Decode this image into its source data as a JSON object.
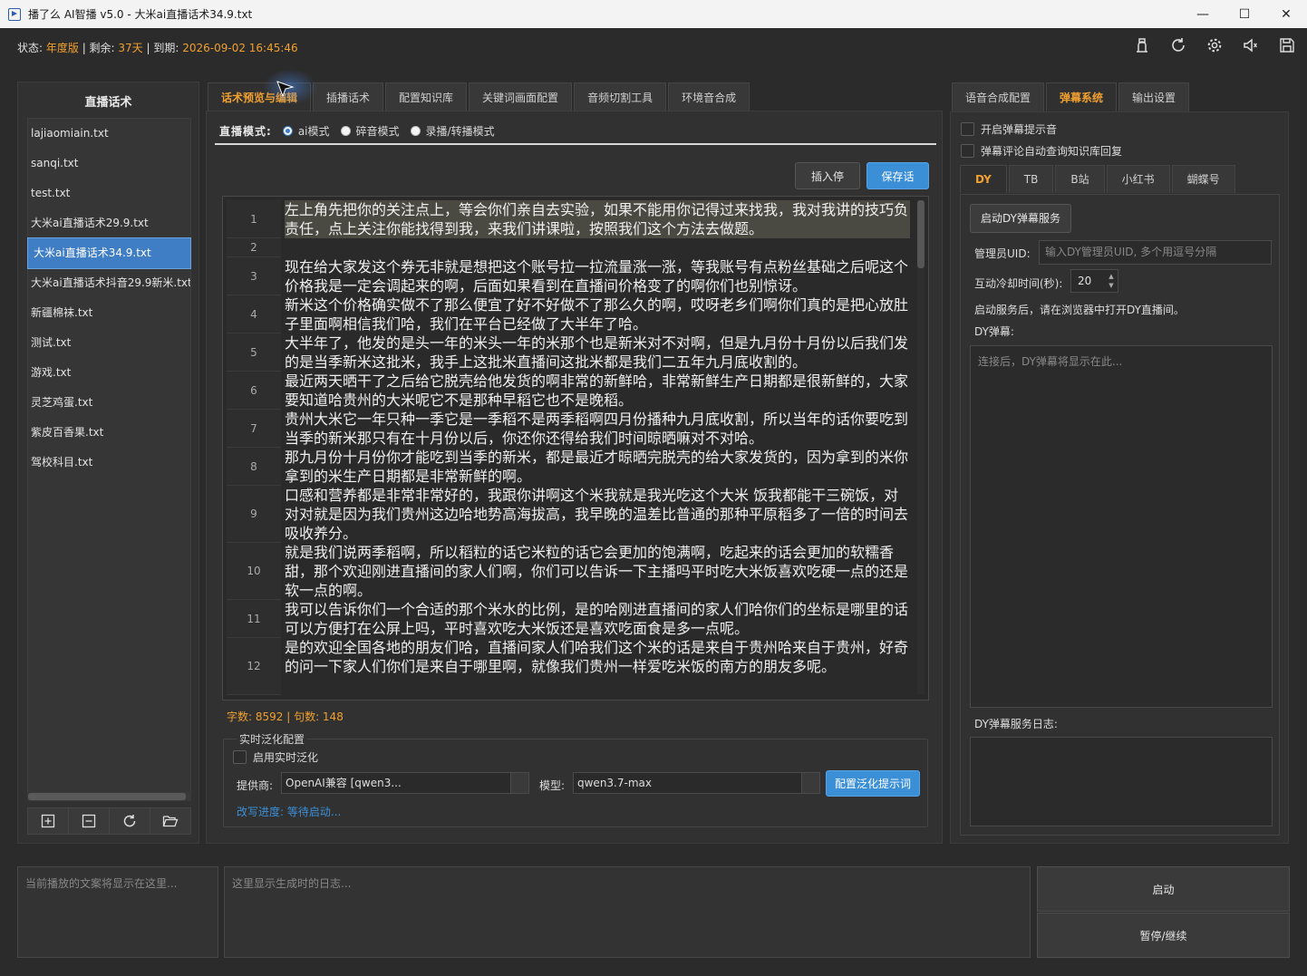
{
  "window": {
    "title": "播了么 AI智播 v5.0 - 大米ai直播话术34.9.txt",
    "controls": {
      "minimize": "—",
      "maximize": "☐",
      "close": "✕"
    }
  },
  "status": {
    "label_state": "状态: ",
    "state_value": "年度版",
    "label_remaining": " | 剩余: ",
    "remaining_value": "37天",
    "label_expire": " | 到期: ",
    "expire_value": "2026-09-02 16:45:46"
  },
  "top_icons": [
    "user-icon",
    "refresh-icon",
    "gear-icon",
    "speaker-icon",
    "save-icon"
  ],
  "left": {
    "heading": "直播话术",
    "files": [
      "lajiaomiain.txt",
      "sanqi.txt",
      "test.txt",
      "大米ai直播话术29.9.txt",
      "大米ai直播话术34.9.txt",
      "大米ai直播话术抖音29.9新米.txt",
      "新疆棉袜.txt",
      "测试.txt",
      "游戏.txt",
      "灵芝鸡蛋.txt",
      "紫皮百香果.txt",
      "驾校科目.txt"
    ],
    "selected_index": 4
  },
  "center": {
    "tabs": [
      "话术预览与编辑",
      "插播话术",
      "配置知识库",
      "关键词画面配置",
      "音频切割工具",
      "环境音合成"
    ],
    "active_tab": 0,
    "mode_label": "直播模式:",
    "modes": [
      "ai模式",
      "碎音模式",
      "录播/转播模式"
    ],
    "active_mode": 0,
    "insert_pause_btn": "插入停顿",
    "save_btn": "保存话术",
    "line_numbers": [
      "1",
      "2",
      "3",
      "4",
      "5",
      "6",
      "7",
      "8",
      "9",
      "10",
      "11",
      "12"
    ],
    "lines": [
      "左上角先把你的关注点上，等会你们亲自去实验，如果不能用你记得过来找我，我对我讲的技巧负责任，点上关注你能找得到我，来我们讲课啦，按照我们这个方法去做题。",
      "",
      "现在给大家发这个券无非就是想把这个账号拉一拉流量涨一涨，等我账号有点粉丝基础之后呢这个价格我是一定会调起来的啊，后面如果看到在直播间价格变了的啊你们也别惊讶。",
      "新米这个价格确实做不了那么便宜了好不好做不了那么久的啊，哎呀老乡们啊你们真的是把心放肚子里面啊相信我们哈，我们在平台已经做了大半年了哈。",
      "大半年了，他发的是头一年的米头一年的米那个也是新米对不对啊，但是九月份十月份以后我们发的是当季新米这批米，我手上这批米直播间这批米都是我们二五年九月底收割的。",
      "最近两天晒干了之后给它脱壳给他发货的啊非常的新鲜哈，非常新鲜生产日期都是很新鲜的，大家要知道哈贵州的大米呢它不是那种早稻它也不是晚稻。",
      "贵州大米它一年只种一季它是一季稻不是两季稻啊四月份播种九月底收割，所以当年的话你要吃到当季的新米那只有在十月份以后，你还你还得给我们时间晾晒嘛对不对哈。",
      "那九月份十月份你才能吃到当季的新米，都是最近才晾晒完脱壳的给大家发货的，因为拿到的米你拿到的米生产日期都是非常新鲜的啊。",
      "口感和营养都是非常非常好的，我跟你讲啊这个米我就是我光吃这个大米 饭我都能干三碗饭，对对对就是因为我们贵州这边哈地势高海拔高，我早晚的温差比普通的那种平原稻多了一倍的时间去吸收养分。",
      "就是我们说两季稻啊，所以稻粒的话它米粒的话它会更加的饱满啊，吃起来的话会更加的软糯香甜，那个欢迎刚进直播间的家人们啊，你们可以告诉一下主播吗平时吃大米饭喜欢吃硬一点的还是软一点的啊。",
      "我可以告诉你们一个合适的那个米水的比例，是的哈刚进直播间的家人们哈你们的坐标是哪里的话可以方便打在公屏上吗，平时喜欢吃大米饭还是喜欢吃面食是多一点呢。",
      "是的欢迎全国各地的朋友们哈，直播间家人们哈我们这个米的话是来自于贵州哈来自于贵州，好奇的问一下家人们你们是来自于哪里啊，就像我们贵州一样爱吃米饭的南方的朋友多呢。"
    ],
    "word_count_text": "字数: 8592 | 句数: 148",
    "realtime": {
      "group_title": "实时泛化配置",
      "enable_label": "启用实时泛化",
      "provider_label": "提供商:",
      "provider_value": "OpenAI兼容 [qwen3...",
      "model_label": "模型:",
      "model_value": "qwen3.7-max",
      "config_btn": "配置泛化提示词",
      "progress_text": "改写进度: 等待启动..."
    }
  },
  "right": {
    "tabs": [
      "语音合成配置",
      "弹幕系统",
      "输出设置"
    ],
    "active_tab": 1,
    "chk_sound": "开启弹幕提示音",
    "chk_auto": "弹幕评论自动查询知识库回复",
    "platform_tabs": [
      "DY",
      "TB",
      "B站",
      "小红书",
      "蝴蝶号"
    ],
    "active_platform": 0,
    "start_service_btn": "启动DY弹幕服务",
    "uid_label": "管理员UID:",
    "uid_placeholder": "输入DY管理员UID, 多个用逗号分隔",
    "cooldown_label": "互动冷却时间(秒):",
    "cooldown_value": "20",
    "hint": "启动服务后，请在浏览器中打开DY直播间。",
    "danmu_label": "DY弹幕:",
    "danmu_placeholder": "连接后，DY弹幕将显示在此...",
    "log_label": "DY弹幕服务日志:"
  },
  "bottom": {
    "current_text_placeholder": "当前播放的文案将显示在这里...",
    "log_placeholder": "这里显示生成时的日志...",
    "start_btn": "启动",
    "pause_btn": "暂停/继续"
  }
}
